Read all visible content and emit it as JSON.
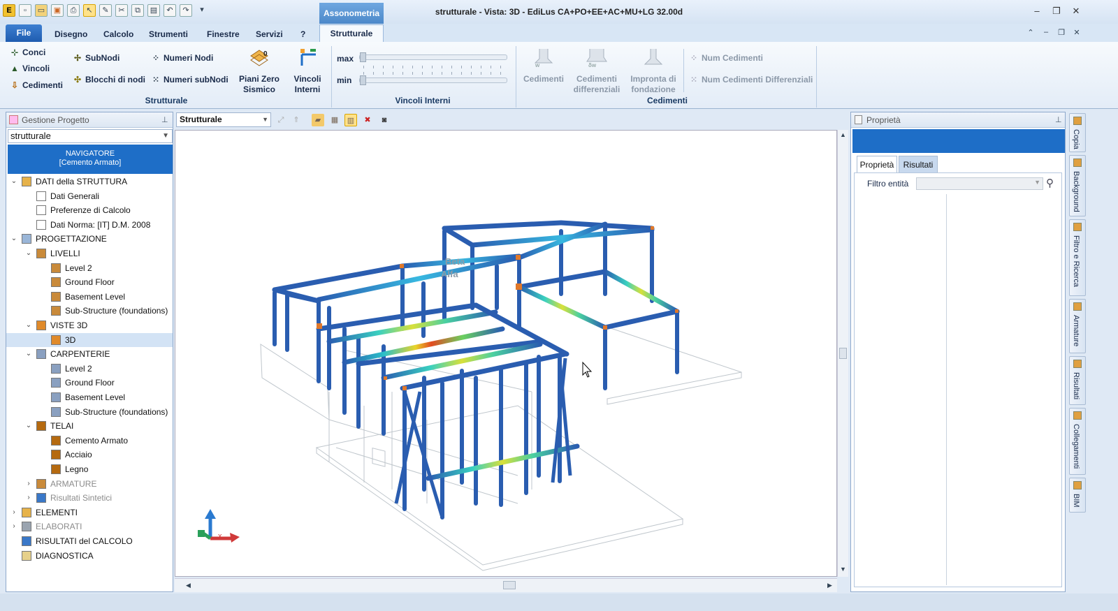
{
  "titlebar": {
    "context_tab": "Assonometria",
    "window_title": "strutturale -  Vista: 3D - EdiLus CA+PO+EE+AC+MU+LG 32.00d"
  },
  "menu": {
    "file": "File",
    "tabs": [
      "Disegno",
      "Calcolo",
      "Strumenti",
      "Finestre",
      "Servizi",
      "?"
    ],
    "active_tab": "Strutturale"
  },
  "ribbon": {
    "strutturale": {
      "group_label": "Strutturale",
      "conci": "Conci",
      "vincoli": "Vincoli",
      "cedimenti": "Cedimenti",
      "subnodi": "SubNodi",
      "blocchi_di_nodi": "Blocchi di nodi",
      "numeri_nodi": "Numeri Nodi",
      "numeri_subnodi": "Numeri subNodi",
      "piani_zero_sismico_1": "Piani Zero",
      "piani_zero_sismico_2": "Sismico",
      "vincoli_interni_1": "Vincoli",
      "vincoli_interni_2": "Interni"
    },
    "vincoli_interni": {
      "group_label": "Vincoli Interni",
      "max_label": "max",
      "min_label": "min"
    },
    "cedimenti": {
      "group_label": "Cedimenti",
      "cedimenti": "Cedimenti",
      "cedimenti_diff_1": "Cedimenti",
      "cedimenti_diff_2": "differenziali",
      "impronta_1": "Impronta di",
      "impronta_2": "fondazione",
      "num_cedimenti": "Num Cedimenti",
      "num_cedimenti_diff": "Num Cedimenti Differenziali"
    }
  },
  "left_panel": {
    "title": "Gestione Progetto",
    "project_select": "strutturale",
    "navigator_line1": "NAVIGATORE",
    "navigator_line2": "[Cemento Armato]",
    "tree": [
      {
        "label": "DATI della STRUTTURA",
        "level": 0,
        "toggle": "v",
        "icon": "folder-icon"
      },
      {
        "label": "Dati Generali",
        "level": 1,
        "toggle": "",
        "icon": "document-icon"
      },
      {
        "label": "Preferenze di Calcolo",
        "level": 1,
        "toggle": "",
        "icon": "document-icon"
      },
      {
        "label": "Dati Norma: [IT] D.M. 2008",
        "level": 1,
        "toggle": "",
        "icon": "document-icon"
      },
      {
        "label": "PROGETTAZIONE",
        "level": 0,
        "toggle": "v",
        "icon": "design-icon"
      },
      {
        "label": "LIVELLI",
        "level": 1,
        "toggle": "v",
        "icon": "levels-icon"
      },
      {
        "label": "Level 2",
        "level": 2,
        "toggle": "",
        "icon": "level-icon"
      },
      {
        "label": "Ground Floor",
        "level": 2,
        "toggle": "",
        "icon": "level-icon"
      },
      {
        "label": "Basement Level",
        "level": 2,
        "toggle": "",
        "icon": "level-icon"
      },
      {
        "label": "Sub-Structure (foundations)",
        "level": 2,
        "toggle": "",
        "icon": "level-icon"
      },
      {
        "label": "VISTE 3D",
        "level": 1,
        "toggle": "v",
        "icon": "view3d-icon"
      },
      {
        "label": "3D",
        "level": 2,
        "toggle": "",
        "icon": "view3d-icon",
        "selected": true
      },
      {
        "label": "CARPENTERIE",
        "level": 1,
        "toggle": "v",
        "icon": "hatch-icon"
      },
      {
        "label": "Level 2",
        "level": 2,
        "toggle": "",
        "icon": "hatch-icon"
      },
      {
        "label": "Ground Floor",
        "level": 2,
        "toggle": "",
        "icon": "hatch-icon"
      },
      {
        "label": "Basement Level",
        "level": 2,
        "toggle": "",
        "icon": "hatch-icon"
      },
      {
        "label": "Sub-Structure (foundations)",
        "level": 2,
        "toggle": "",
        "icon": "hatch-icon"
      },
      {
        "label": "TELAI",
        "level": 1,
        "toggle": "v",
        "icon": "frame-icon"
      },
      {
        "label": "Cemento Armato",
        "level": 2,
        "toggle": "",
        "icon": "frame-icon"
      },
      {
        "label": "Acciaio",
        "level": 2,
        "toggle": "",
        "icon": "frame-icon"
      },
      {
        "label": "Legno",
        "level": 2,
        "toggle": "",
        "icon": "frame-icon"
      },
      {
        "label": "ARMATURE",
        "level": 1,
        "toggle": ">",
        "icon": "rebar-icon",
        "gray": true
      },
      {
        "label": "Risultati Sintetici",
        "level": 1,
        "toggle": ">",
        "icon": "results-icon",
        "gray": true
      },
      {
        "label": "ELEMENTI",
        "level": 0,
        "toggle": ">",
        "icon": "elements-icon"
      },
      {
        "label": "ELABORATI",
        "level": 0,
        "toggle": ">",
        "icon": "drawings-icon",
        "gray": true
      },
      {
        "label": "RISULTATI del CALCOLO",
        "level": 0,
        "toggle": "",
        "icon": "results-icon"
      },
      {
        "label": "DIAGNOSTICA",
        "level": 0,
        "toggle": "",
        "icon": "diagnostic-icon"
      }
    ]
  },
  "viewport": {
    "view_select": "Strutturale",
    "overlay_text_1": "Beta",
    "overlay_text_2": "Alfa",
    "axis_x": "x"
  },
  "right_panel": {
    "title": "Proprietà",
    "tab_properties": "Proprietà",
    "tab_results": "Risultati",
    "filter_label": "Filtro entità"
  },
  "side_strip": [
    "Copia",
    "Background",
    "Filtro e Ricerca",
    "Armature",
    "Risultati",
    "Collegamenti",
    "BIM"
  ],
  "colors": {
    "ribbon_blue": "#1e6ec7",
    "beam_blue": "#2a5db0",
    "accent_orange": "#e0782a"
  }
}
